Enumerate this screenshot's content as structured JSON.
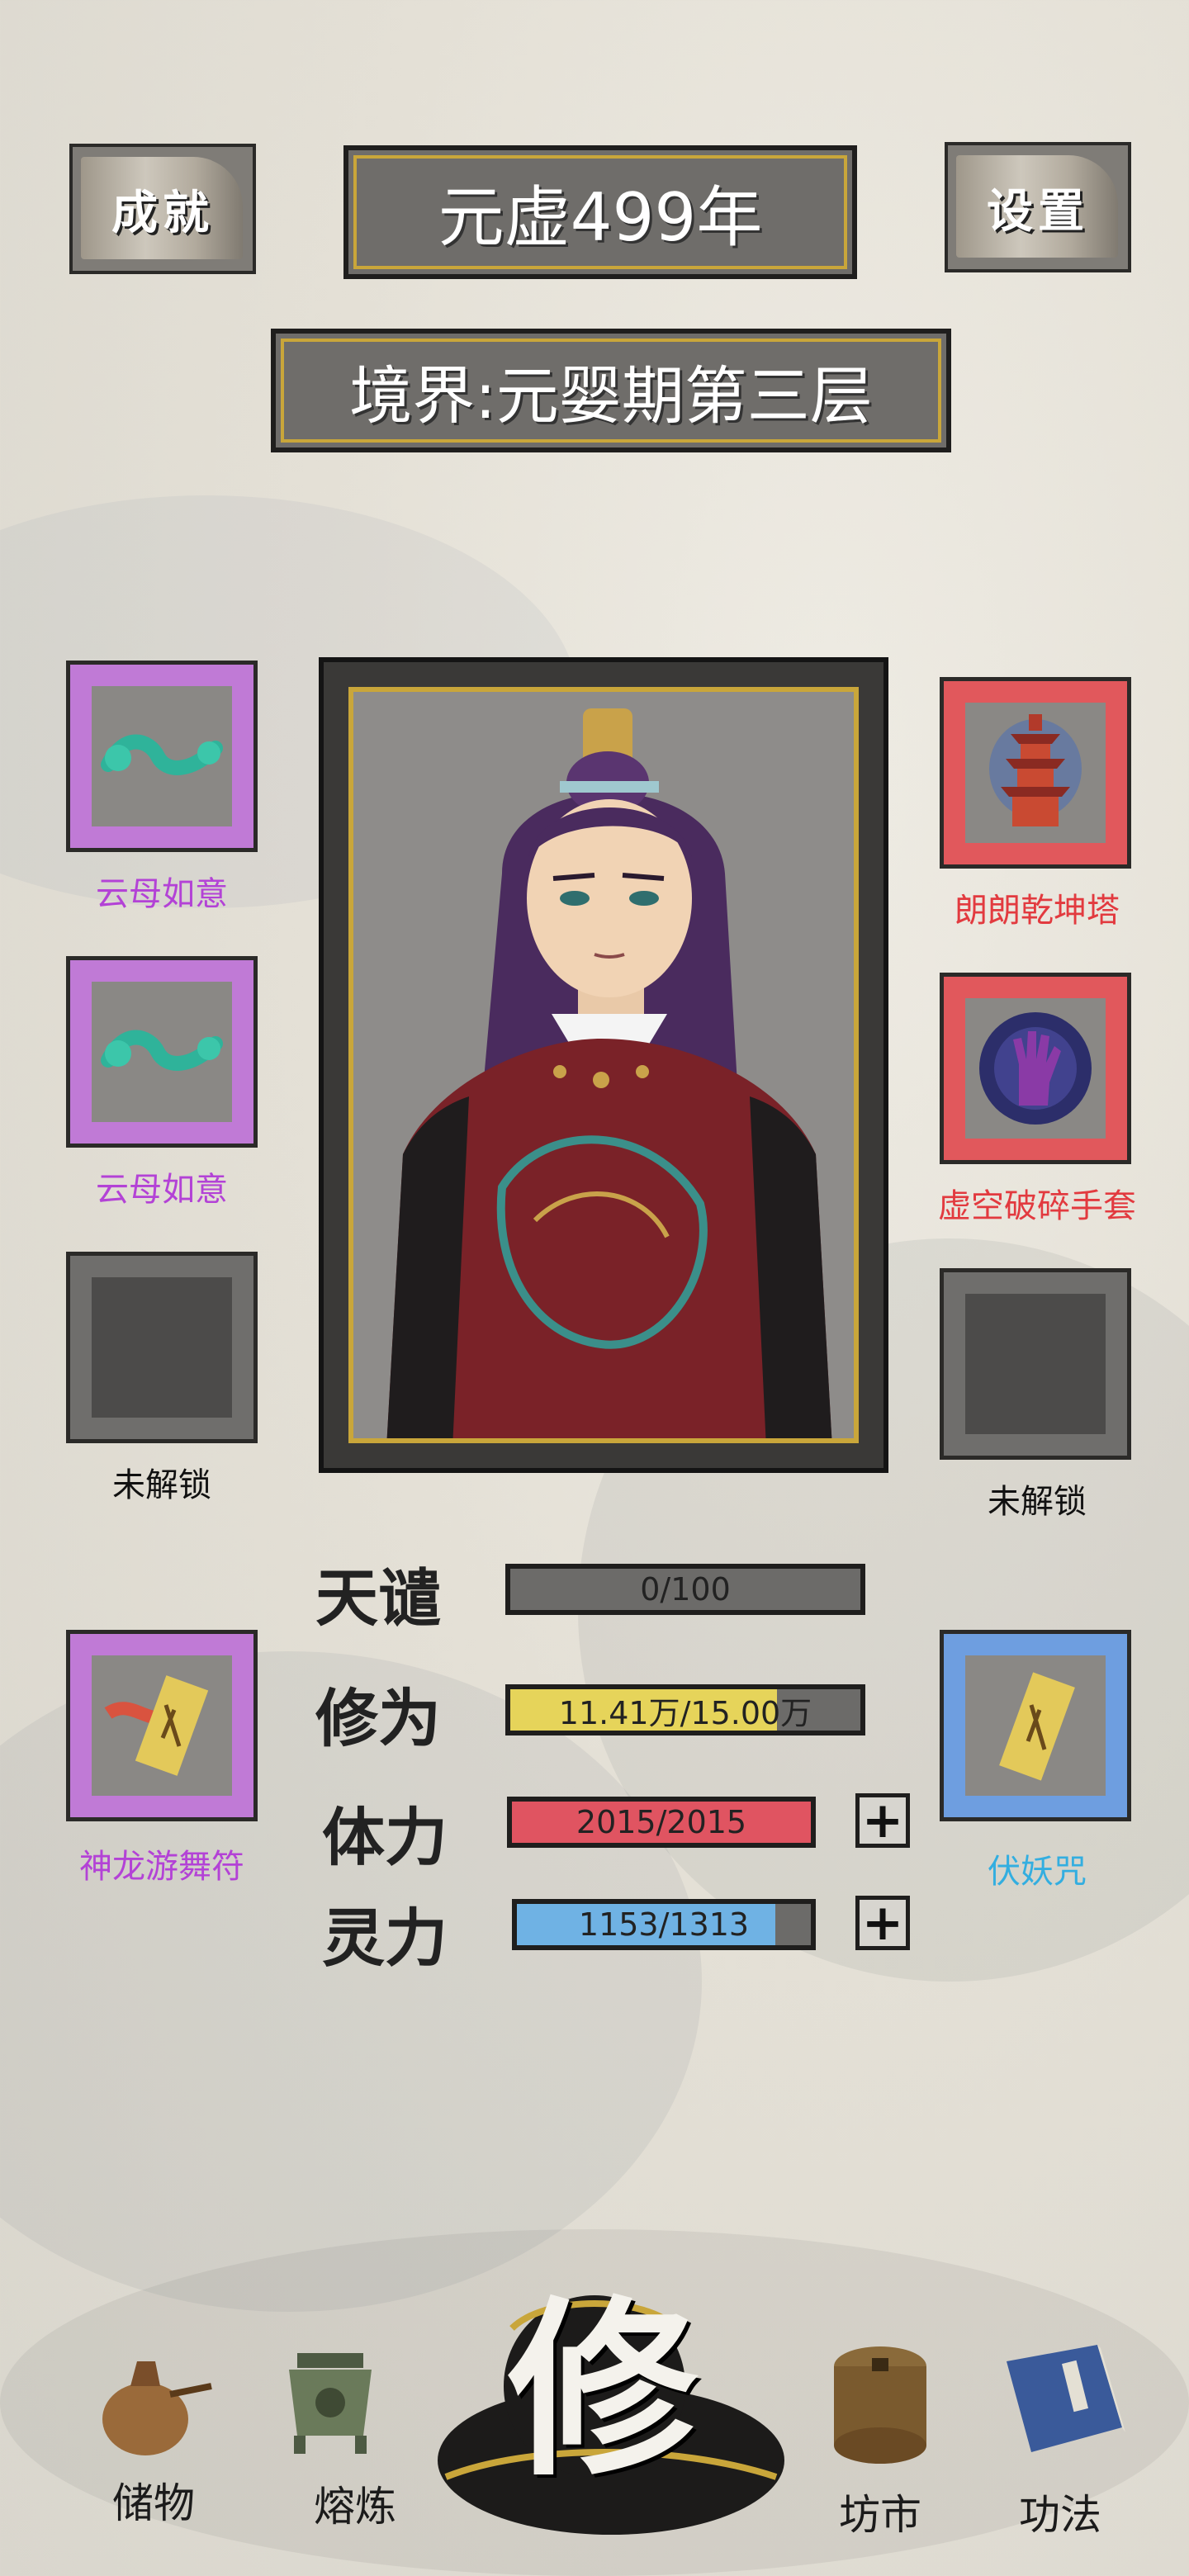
{
  "header": {
    "achievements_label": "成就",
    "year_label": "元虚499年",
    "settings_label": "设置",
    "realm_label": "境界:元婴期第三层"
  },
  "left_slots": [
    {
      "label": "云母如意",
      "rarity": "purple",
      "icon": "jade-ruyi-icon"
    },
    {
      "label": "云母如意",
      "rarity": "purple",
      "icon": "jade-ruyi-icon"
    },
    {
      "label": "未解锁",
      "rarity": "locked",
      "icon": "locked-slot"
    }
  ],
  "right_slots": [
    {
      "label": "朗朗乾坤塔",
      "rarity": "red",
      "icon": "pagoda-icon"
    },
    {
      "label": "虚空破碎手套",
      "rarity": "red",
      "icon": "void-gauntlet-icon"
    },
    {
      "label": "未解锁",
      "rarity": "locked",
      "icon": "locked-slot"
    }
  ],
  "talismans": {
    "left": {
      "label": "神龙游舞符",
      "rarity": "purple",
      "icon": "dragon-talisman-icon"
    },
    "right": {
      "label": "伏妖咒",
      "rarity": "blue",
      "icon": "demon-seal-talisman-icon"
    }
  },
  "stats": {
    "tribulation": {
      "label": "天谴",
      "value": "0/100",
      "current": 0,
      "max": 100
    },
    "cultivation": {
      "label": "修为",
      "value": "11.41万/15.00万",
      "current": 11.41,
      "max": 15.0
    },
    "stamina": {
      "label": "体力",
      "value": "2015/2015",
      "current": 2015,
      "max": 2015
    },
    "spirit": {
      "label": "灵力",
      "value": "1153/1313",
      "current": 1153,
      "max": 1313
    }
  },
  "colors": {
    "purple_rarity": "#c07ad6",
    "red_rarity": "#e1585c",
    "blue_rarity": "#6e9ee0",
    "purple_text": "#b342d6",
    "red_text": "#e23a3f",
    "blue_text": "#33aee0",
    "cultivation_fill": "#e6d45a",
    "stamina_fill": "#e05461",
    "spirit_fill": "#6fb2e4",
    "gold_trim": "#c9a63a"
  },
  "nav": {
    "storage": "储物",
    "refine": "熔炼",
    "cultivate": "修",
    "market": "坊市",
    "skills": "功法"
  }
}
